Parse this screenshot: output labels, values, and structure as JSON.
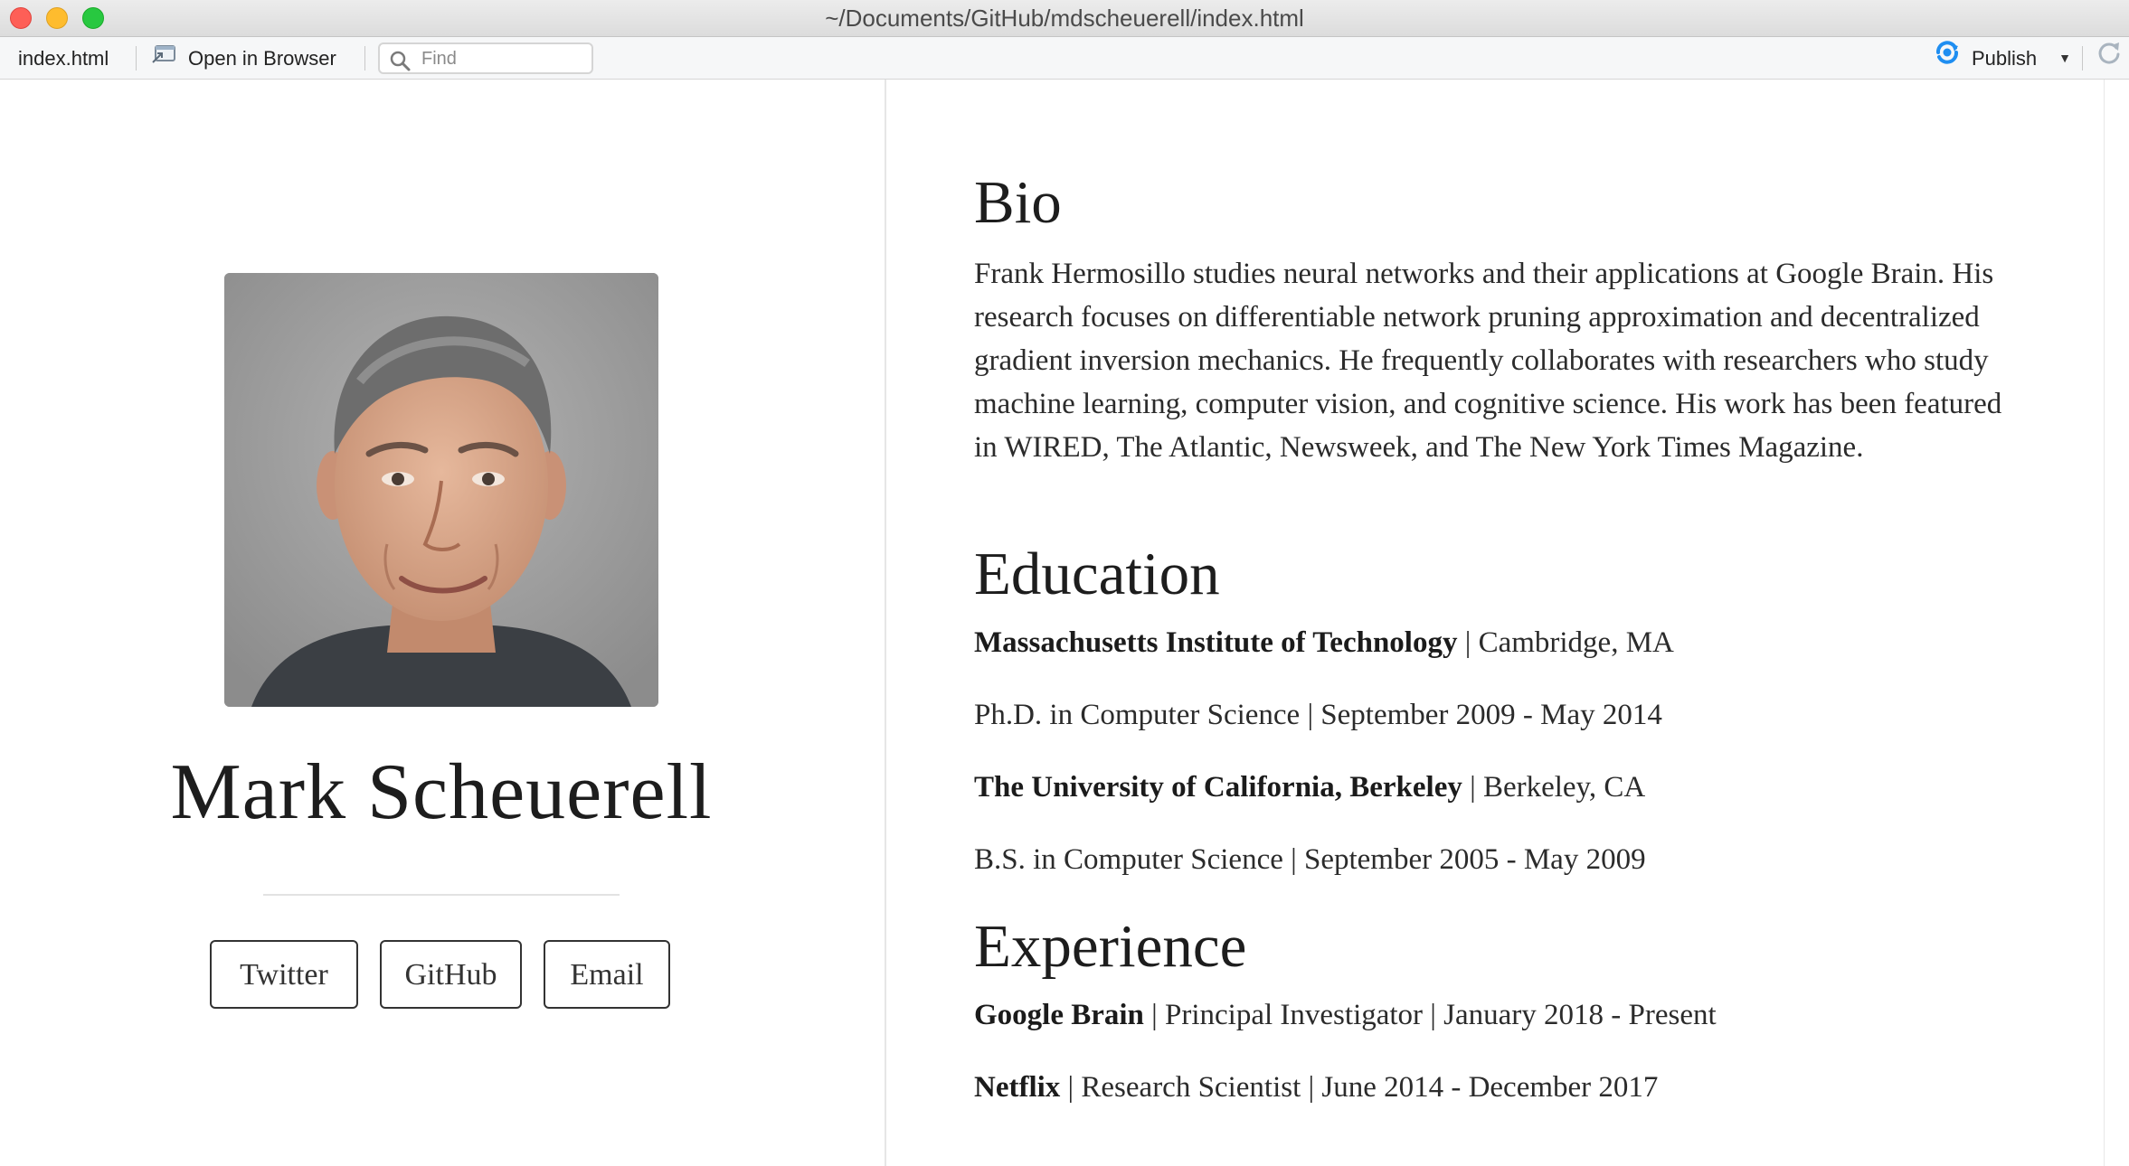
{
  "window": {
    "title": "~/Documents/GitHub/mdscheuerell/index.html"
  },
  "toolbar": {
    "filename": "index.html",
    "open_in_browser": "Open in Browser",
    "find_placeholder": "Find",
    "publish_label": "Publish"
  },
  "profile": {
    "name": "Mark Scheuerell",
    "links": [
      "Twitter",
      "GitHub",
      "Email"
    ]
  },
  "sections": {
    "bio": {
      "heading": "Bio",
      "text": "Frank Hermosillo studies neural networks and their applications at Google Brain. His research focuses on differentiable network pruning approximation and decentralized gradient inversion mechanics. He frequently collaborates with researchers who study machine learning, computer vision, and cognitive science. His work has been featured in WIRED, The Atlantic, Newsweek, and The New York Times Magazine."
    },
    "education": {
      "heading": "Education",
      "items": [
        {
          "school": "Massachusetts Institute of Technology",
          "location": " | Cambridge, MA",
          "degree": "Ph.D. in Computer Science | September 2009 - May 2014"
        },
        {
          "school": "The University of California, Berkeley",
          "location": " | Berkeley, CA",
          "degree": "B.S. in Computer Science | September 2005 - May 2009"
        }
      ]
    },
    "experience": {
      "heading": "Experience",
      "items": [
        {
          "org": "Google Brain",
          "detail": " | Principal Investigator | January 2018 - Present"
        },
        {
          "org": "Netflix",
          "detail": " | Research Scientist | June 2014 - December 2017"
        }
      ]
    }
  },
  "colors": {
    "traffic_close": "#fe5f57",
    "traffic_minimize": "#febc2e",
    "traffic_maximize": "#28c840",
    "publish_icon": "#1f8ef1"
  },
  "icons": [
    "open-in-browser-icon",
    "search-icon",
    "publish-icon",
    "refresh-icon"
  ]
}
